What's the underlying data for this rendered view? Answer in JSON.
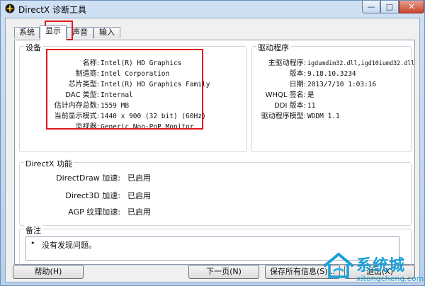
{
  "window": {
    "title": "DirectX 诊断工具",
    "icon": "directx-logo-icon"
  },
  "tabs": [
    {
      "label": "系统",
      "active": false
    },
    {
      "label": "显示",
      "active": true
    },
    {
      "label": "声音",
      "active": false
    },
    {
      "label": "输入",
      "active": false
    }
  ],
  "device": {
    "title": "设备",
    "rows": [
      {
        "label": "名称:",
        "value": "Intel(R) HD Graphics"
      },
      {
        "label": "制造商:",
        "value": "Intel Corporation"
      },
      {
        "label": "芯片类型:",
        "value": "Intel(R) HD Graphics Family"
      },
      {
        "label": "DAC 类型:",
        "value": "Internal"
      },
      {
        "label": "估计内存总数:",
        "value": "1559 MB"
      },
      {
        "label": "当前显示模式:",
        "value": "1440 x 900 (32 bit) (60Hz)"
      },
      {
        "label": "监视器:",
        "value": "Generic Non-PnP Monitor"
      }
    ]
  },
  "drivers": {
    "title": "驱动程序",
    "rows": [
      {
        "label": "主驱动程序:",
        "value": "igdumdim32.dll,igd10iumd32.dll"
      },
      {
        "label": "版本:",
        "value": "9.18.10.3234"
      },
      {
        "label": "日期:",
        "value": "2013/7/10 1:03:16"
      },
      {
        "label": "WHQL 签名:",
        "value": "是"
      },
      {
        "label": "DDI 版本:",
        "value": "11"
      },
      {
        "label": "驱动程序模型:",
        "value": "WDDM 1.1"
      }
    ]
  },
  "directx_features": {
    "title": "DirectX 功能",
    "rows": [
      {
        "label": "DirectDraw 加速:",
        "value": "已启用"
      },
      {
        "label": "Direct3D 加速:",
        "value": "已启用"
      },
      {
        "label": "AGP 纹理加速:",
        "value": "已启用"
      }
    ]
  },
  "notes": {
    "title": "备注",
    "lines": [
      "没有发现问题。"
    ]
  },
  "buttons": {
    "help": "帮助(H)",
    "next_page": "下一页(N)",
    "save_all": "保存所有信息(S)...",
    "exit": "退出(X)"
  },
  "watermark": {
    "brand": "系统城",
    "url": "xitongcheng.com"
  },
  "colors": {
    "highlight": "#e0171d",
    "title_bar": "#cfe0f3"
  }
}
